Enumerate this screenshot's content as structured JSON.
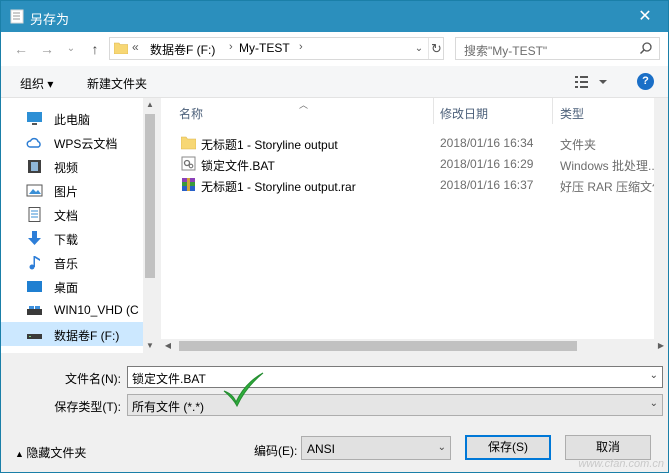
{
  "window": {
    "title": "另存为",
    "close_label": "✕"
  },
  "nav": {
    "back_label": "←",
    "forward_label": "→",
    "recent_label": "⌄",
    "up_label": "↑",
    "address_prefix": "«",
    "breadcrumb": [
      "数据卷F (F:)",
      "My-TEST"
    ],
    "search_placeholder": "搜索\"My-TEST\""
  },
  "toolbar": {
    "organize_label": "组织 ▾",
    "new_folder_label": "新建文件夹",
    "help_label": "?"
  },
  "sidebar": {
    "items": [
      {
        "label": "此电脑",
        "icon": "pc-icon"
      },
      {
        "label": "WPS云文档",
        "icon": "cloud-icon"
      },
      {
        "label": "视频",
        "icon": "video-icon"
      },
      {
        "label": "图片",
        "icon": "picture-icon"
      },
      {
        "label": "文档",
        "icon": "document-icon"
      },
      {
        "label": "下载",
        "icon": "download-icon"
      },
      {
        "label": "音乐",
        "icon": "music-icon"
      },
      {
        "label": "桌面",
        "icon": "desktop-icon"
      },
      {
        "label": "WIN10_VHD (C",
        "icon": "drive-icon"
      },
      {
        "label": "数据卷F (F:)",
        "icon": "drive-icon",
        "selected": true
      }
    ]
  },
  "file_list": {
    "columns": [
      "名称",
      "修改日期",
      "类型"
    ],
    "rows": [
      {
        "name": "无标题1 - Storyline output",
        "date": "2018/01/16 16:34",
        "type": "文件夹",
        "icon": "folder-icon"
      },
      {
        "name": "锁定文件.BAT",
        "date": "2018/01/16 16:29",
        "type": "Windows 批处理...",
        "icon": "bat-file-icon"
      },
      {
        "name": "无标题1 - Storyline output.rar",
        "date": "2018/01/16 16:37",
        "type": "好压 RAR 压缩文件",
        "icon": "rar-file-icon"
      }
    ]
  },
  "form": {
    "filename_label": "文件名(N):",
    "filename_value": "锁定文件.BAT",
    "filetype_label": "保存类型(T):",
    "filetype_value": "所有文件 (*.*)"
  },
  "bottom": {
    "hide_folders_label": "隐藏文件夹",
    "encoding_label": "编码(E):",
    "encoding_value": "ANSI",
    "save_label": "保存(S)",
    "cancel_label": "取消"
  },
  "watermark": "www.cfan.com.cn",
  "colors": {
    "title_bar": "#2b8fbd",
    "selection": "#cce8ff",
    "check": "#2fae3c"
  }
}
